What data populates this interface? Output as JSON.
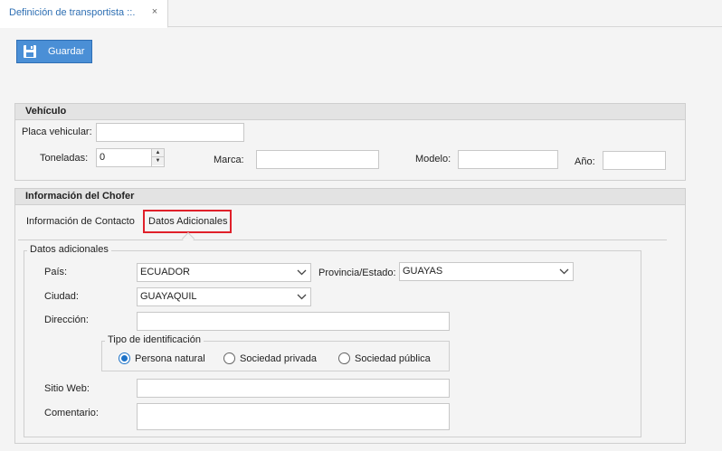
{
  "tab": {
    "title": "Definición de transportista ::.",
    "close": "×"
  },
  "toolbar": {
    "save_label": "Guardar"
  },
  "vehiculo": {
    "header": "Vehículo",
    "placa_label": "Placa vehicular:",
    "placa_value": "",
    "toneladas_label": "Toneladas:",
    "toneladas_value": "0",
    "marca_label": "Marca:",
    "marca_value": "",
    "modelo_label": "Modelo:",
    "modelo_value": "",
    "anio_label": "Año:",
    "anio_value": ""
  },
  "chofer": {
    "header": "Información del Chofer",
    "tabs": [
      {
        "label": "Información de Contacto",
        "active": false
      },
      {
        "label": "Datos Adicionales",
        "active": true
      }
    ],
    "datos": {
      "legend": "Datos adicionales",
      "pais_label": "País:",
      "pais_value": "ECUADOR",
      "provincia_label": "Provincia/Estado:",
      "provincia_value": "GUAYAS",
      "ciudad_label": "Ciudad:",
      "ciudad_value": "GUAYAQUIL",
      "direccion_label": "Dirección:",
      "direccion_value": "",
      "tipo_id": {
        "legend": "Tipo de identificación",
        "options": [
          {
            "label": "Persona natural",
            "selected": true
          },
          {
            "label": "Sociedad privada",
            "selected": false
          },
          {
            "label": "Sociedad pública",
            "selected": false
          }
        ]
      },
      "sitio_label": "Sitio Web:",
      "sitio_value": "",
      "comentario_label": "Comentario:",
      "comentario_value": ""
    }
  },
  "colors": {
    "accent": "#4a8fd6",
    "tab_title": "#2e6fb3",
    "highlight": "#e0202a",
    "radio": "#1e73c8"
  },
  "icons": {
    "save": "floppy-disk-icon",
    "close": "close-icon",
    "dropdown": "chevron-down-icon",
    "spin_up": "spin-up-icon",
    "spin_down": "spin-down-icon"
  }
}
